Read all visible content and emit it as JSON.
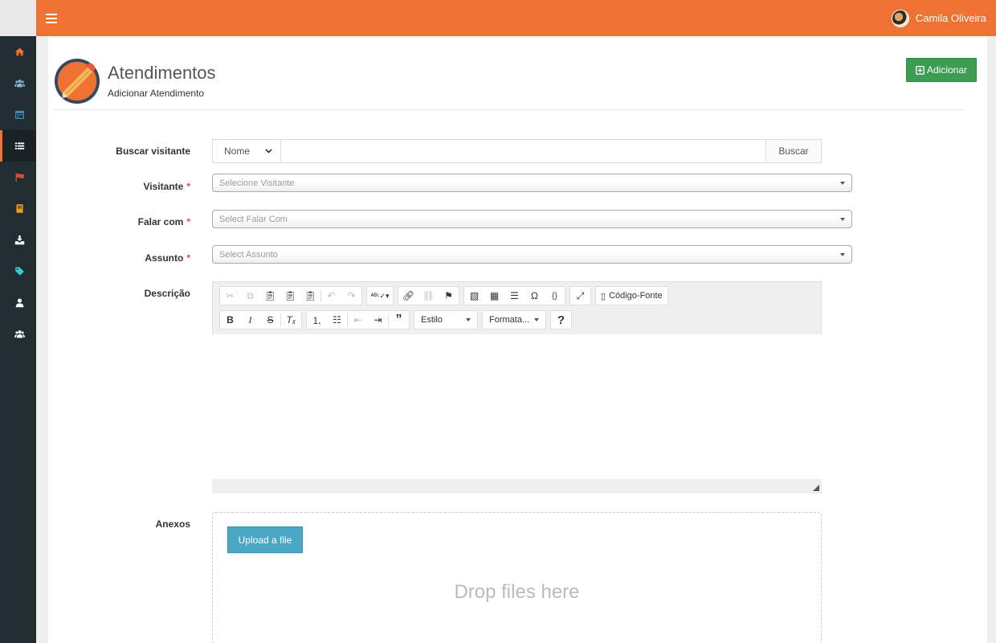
{
  "user": {
    "name": "Camila Oliveira"
  },
  "header": {
    "title": "Atendimentos",
    "subtitle": "Adicionar Atendimento",
    "add_label": "Adicionar"
  },
  "form": {
    "search_label": "Buscar visitante",
    "search_type": "Nome",
    "search_button": "Buscar",
    "visitante_label": "Visitante",
    "visitante_placeholder": "Selecione Visitante",
    "falar_label": "Falar com",
    "falar_placeholder": "Select Falar Com",
    "assunto_label": "Assunto",
    "assunto_placeholder": "Select Assunto",
    "required_mark": "*",
    "descricao_label": "Descrição",
    "anexos_label": "Anexos"
  },
  "editor": {
    "source_label": "Código-Fonte",
    "style_label": "Estilo",
    "format_label": "Formata..."
  },
  "upload": {
    "button": "Upload a file",
    "drop_text": "Drop files here"
  },
  "colors": {
    "accent": "#ef7134",
    "sidebar": "#222d32",
    "success": "#3c9d52",
    "info": "#4ba8c4"
  },
  "sidebar_icons": [
    "home-icon",
    "users-icon",
    "calendar-icon",
    "list-icon",
    "flag-icon",
    "book-icon",
    "download-icon",
    "tag-icon",
    "user-icon",
    "group-icon"
  ]
}
